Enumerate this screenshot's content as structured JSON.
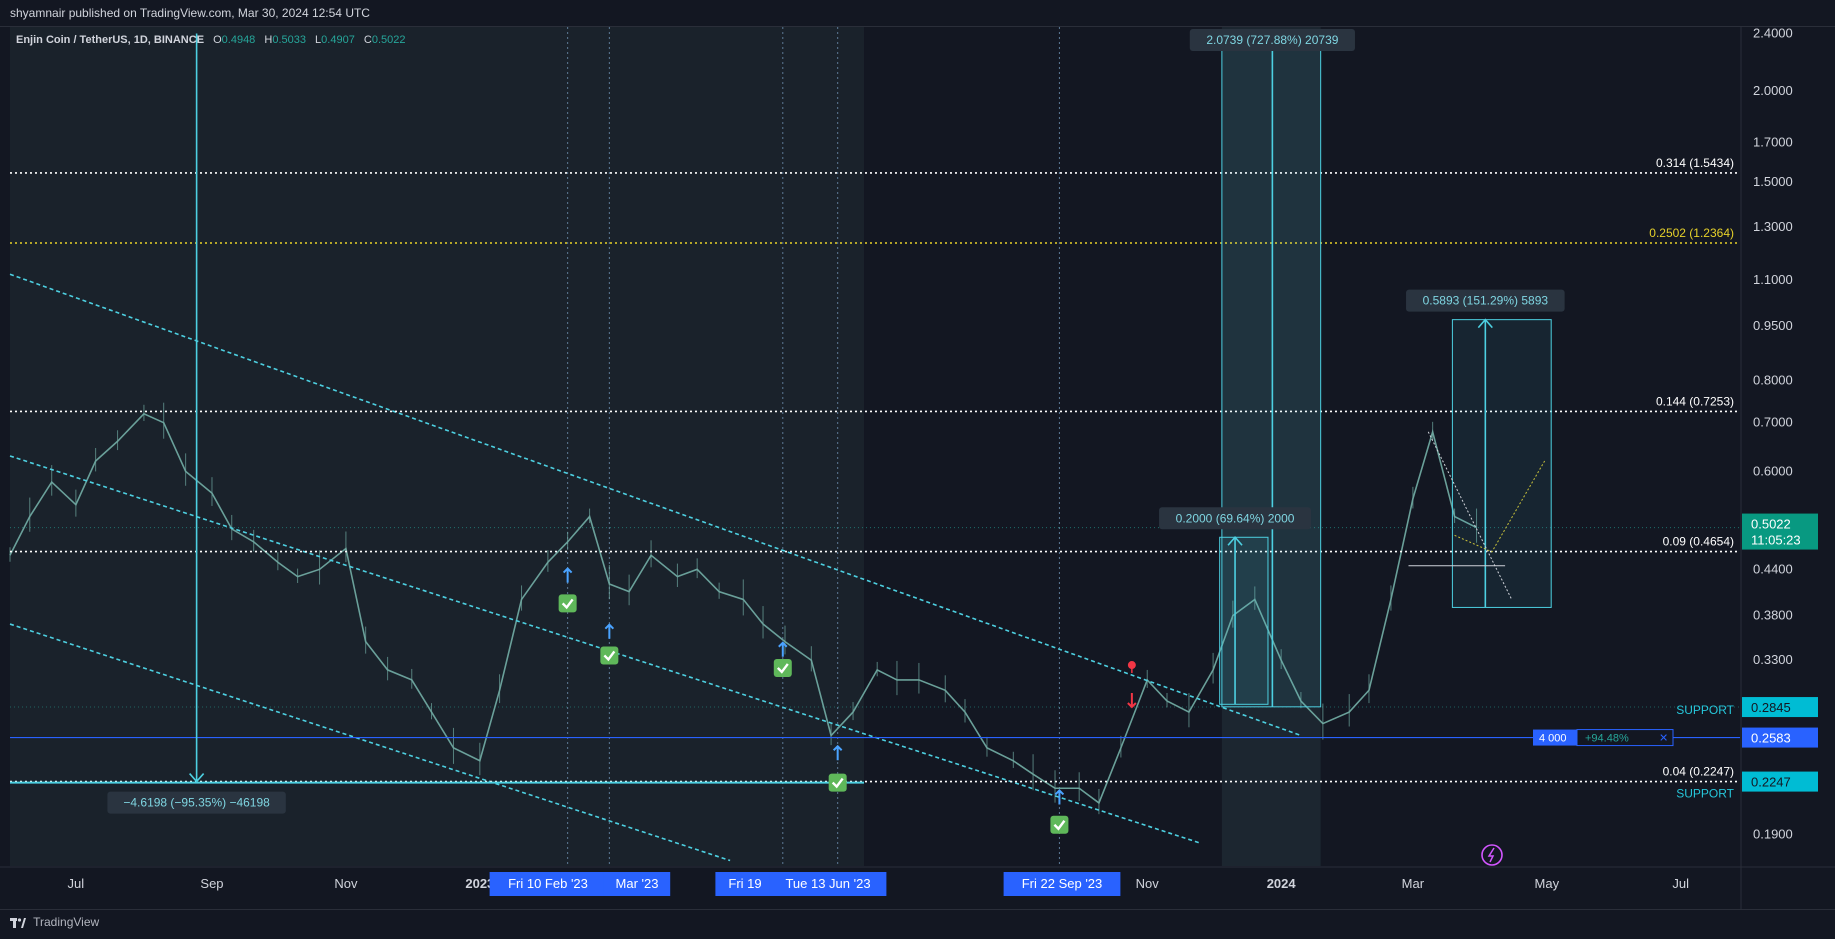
{
  "header": {
    "publish_text": "shyamnair published on TradingView.com, Mar 30, 2024 12:54 UTC"
  },
  "footer": {
    "brand": "TradingView"
  },
  "legend": {
    "symbol": "Enjin Coin / TetherUS, 1D, BINANCE",
    "o_label": "O",
    "o_value": "0.4948",
    "h_label": "H",
    "h_value": "0.5033",
    "l_label": "L",
    "l_value": "0.4907",
    "c_label": "C",
    "c_value": "0.5022"
  },
  "colors": {
    "background": "#131722",
    "candle": "#6fa8a0",
    "channel": "#4dd0e1",
    "fib_white": "#ffffff",
    "fib_yellow": "#e6d12a",
    "measure": "#4dd0e1",
    "support_blue": "#2962ff",
    "current_price_bg": "#089981",
    "date_label_bg": "#2962ff"
  },
  "chart_data": {
    "type": "line",
    "log_scale": true,
    "ylim": [
      0.175,
      2.4
    ],
    "y_ticks": [
      "2.4000",
      "2.0000",
      "1.7000",
      "1.5000",
      "1.3000",
      "1.1000",
      "0.9500",
      "0.8000",
      "0.7000",
      "0.6000",
      "0.4400",
      "0.3800",
      "0.3300",
      "0.1900"
    ],
    "x_ticks": [
      {
        "date": "2022-07-01",
        "label": "Jul"
      },
      {
        "date": "2022-09-01",
        "label": "Sep"
      },
      {
        "date": "2022-11-01",
        "label": "Nov"
      },
      {
        "date": "2023-01-01",
        "label": "2023"
      },
      {
        "date": "2023-11-01",
        "label": "Nov"
      },
      {
        "date": "2024-01-01",
        "label": "2024"
      },
      {
        "date": "2024-03-01",
        "label": "Mar"
      },
      {
        "date": "2024-05-01",
        "label": "May"
      },
      {
        "date": "2024-07-01",
        "label": "Jul"
      }
    ],
    "date_labels": [
      {
        "date": "2023-02-10",
        "label": "Fri 10 Feb '23"
      },
      {
        "date": "2023-03-01",
        "label": "Mar '23"
      },
      {
        "date": "2023-05-19",
        "label": "Fri 19"
      },
      {
        "date": "2023-06-13",
        "label": "Tue 13 Jun '23"
      },
      {
        "date": "2023-09-22",
        "label": "Fri 22 Sep '23"
      }
    ],
    "series": [
      {
        "x": [
          "2022-06-01",
          "2022-06-10",
          "2022-06-20",
          "2022-07-01",
          "2022-07-10",
          "2022-07-20",
          "2022-08-01",
          "2022-08-10",
          "2022-08-20",
          "2022-09-01",
          "2022-09-10",
          "2022-09-20",
          "2022-10-01",
          "2022-10-10",
          "2022-10-20",
          "2022-11-01",
          "2022-11-10",
          "2022-11-20",
          "2022-12-01",
          "2022-12-10",
          "2022-12-20",
          "2023-01-01",
          "2023-01-10",
          "2023-01-20",
          "2023-02-01",
          "2023-02-10",
          "2023-02-20",
          "2023-03-01",
          "2023-03-10",
          "2023-03-20",
          "2023-04-01",
          "2023-04-10",
          "2023-04-20",
          "2023-05-01",
          "2023-05-10",
          "2023-05-20",
          "2023-06-01",
          "2023-06-10",
          "2023-06-20",
          "2023-07-01",
          "2023-07-10",
          "2023-07-20",
          "2023-08-01",
          "2023-08-10",
          "2023-08-20",
          "2023-09-01",
          "2023-09-10",
          "2023-09-20",
          "2023-10-01",
          "2023-10-10",
          "2023-10-20",
          "2023-11-01",
          "2023-11-10",
          "2023-11-20",
          "2023-12-01",
          "2023-12-10",
          "2023-12-20",
          "2024-01-01",
          "2024-01-10",
          "2024-01-20",
          "2024-02-01",
          "2024-02-10",
          "2024-02-20",
          "2024-03-01",
          "2024-03-10",
          "2024-03-20",
          "2024-03-30"
        ],
        "y": [
          0.46,
          0.52,
          0.58,
          0.54,
          0.62,
          0.66,
          0.72,
          0.7,
          0.6,
          0.56,
          0.5,
          0.48,
          0.45,
          0.43,
          0.44,
          0.47,
          0.35,
          0.32,
          0.31,
          0.28,
          0.25,
          0.24,
          0.3,
          0.4,
          0.45,
          0.48,
          0.52,
          0.42,
          0.41,
          0.46,
          0.43,
          0.44,
          0.41,
          0.4,
          0.37,
          0.35,
          0.33,
          0.26,
          0.28,
          0.32,
          0.31,
          0.31,
          0.3,
          0.28,
          0.25,
          0.24,
          0.23,
          0.22,
          0.22,
          0.21,
          0.25,
          0.31,
          0.29,
          0.28,
          0.32,
          0.38,
          0.4,
          0.33,
          0.29,
          0.27,
          0.28,
          0.3,
          0.4,
          0.55,
          0.68,
          0.52,
          0.5022
        ]
      }
    ]
  },
  "fib_levels": [
    {
      "label": "0.314 (1.5434)",
      "price": 1.5434,
      "color": "#ffffff"
    },
    {
      "label": "0.2502 (1.2364)",
      "price": 1.2364,
      "color": "#e6d12a"
    },
    {
      "label": "0.144 (0.7253)",
      "price": 0.7253,
      "color": "#ffffff"
    },
    {
      "label": "0.09 (0.4654)",
      "price": 0.4654,
      "color": "#ffffff"
    },
    {
      "label": "0.04 (0.2247)",
      "price": 0.2247,
      "color": "#ffffff"
    }
  ],
  "channel_lines": [
    {
      "x1": "2022-06-01",
      "y1": 1.12,
      "x2": "2024-01-10",
      "y2": 0.26
    },
    {
      "x1": "2022-06-01",
      "y1": 0.63,
      "x2": "2023-11-25",
      "y2": 0.185
    },
    {
      "x1": "2022-06-01",
      "y1": 0.37,
      "x2": "2023-04-25",
      "y2": 0.175
    }
  ],
  "support": {
    "price": 0.2583,
    "label": "SUPPORT",
    "order_qty": "4 000",
    "order_pct": "+94.48%",
    "close_symbol": "✕"
  },
  "price_labels": [
    {
      "value": "0.2845",
      "price": 0.2845,
      "kind": "teal"
    },
    {
      "value": "0.2583",
      "price": 0.2583,
      "kind": "blue"
    },
    {
      "value": "0.2247",
      "price": 0.2247,
      "kind": "teal"
    }
  ],
  "support_text": [
    {
      "label": "SUPPORT",
      "price": 0.282
    },
    {
      "label": "SUPPORT",
      "price": 0.2165
    }
  ],
  "current_price": {
    "value": "0.5022",
    "countdown": "11:05:23",
    "price": 0.5022
  },
  "measures": [
    {
      "label": "2.0739 (727.88%) 20739",
      "x": "2023-12-28",
      "from": 0.2847,
      "to": 2.4,
      "box_x1": "2023-12-05",
      "box_x2": "2024-01-19"
    },
    {
      "label": "0.5893 (151.29%) 5893",
      "x": "2024-04-03",
      "from": 0.39,
      "to": 0.97,
      "box_x1": "2024-03-19",
      "box_x2": "2024-05-03"
    },
    {
      "label": "0.2000 (69.64%) 2000",
      "x": "2023-12-11",
      "from": 0.287,
      "to": 0.487,
      "box_x1": "2023-12-04",
      "box_x2": "2023-12-26"
    },
    {
      "label": "−4.6198 (−95.35%) −46198",
      "x": "2022-08-25",
      "from": 2.4,
      "to": 0.2247,
      "box_x1": "2022-08-25",
      "box_x2": "2022-08-25"
    }
  ],
  "signals": [
    {
      "date": "2023-02-10",
      "price": 0.395,
      "kind": "check"
    },
    {
      "date": "2023-03-01",
      "price": 0.335,
      "kind": "check"
    },
    {
      "date": "2023-05-19",
      "price": 0.322,
      "kind": "check"
    },
    {
      "date": "2023-06-13",
      "price": 0.224,
      "kind": "check"
    },
    {
      "date": "2023-09-22",
      "price": 0.196,
      "kind": "check"
    },
    {
      "date": "2023-02-10",
      "price": 0.43,
      "kind": "arrow-up"
    },
    {
      "date": "2023-03-01",
      "price": 0.36,
      "kind": "arrow-up"
    },
    {
      "date": "2023-05-19",
      "price": 0.34,
      "kind": "arrow-up"
    },
    {
      "date": "2023-06-13",
      "price": 0.245,
      "kind": "arrow-up"
    },
    {
      "date": "2023-09-22",
      "price": 0.213,
      "kind": "arrow-up"
    },
    {
      "date": "2023-10-25",
      "price": 0.29,
      "kind": "arrow-down"
    },
    {
      "date": "2023-10-25",
      "price": 0.325,
      "kind": "pin"
    }
  ]
}
